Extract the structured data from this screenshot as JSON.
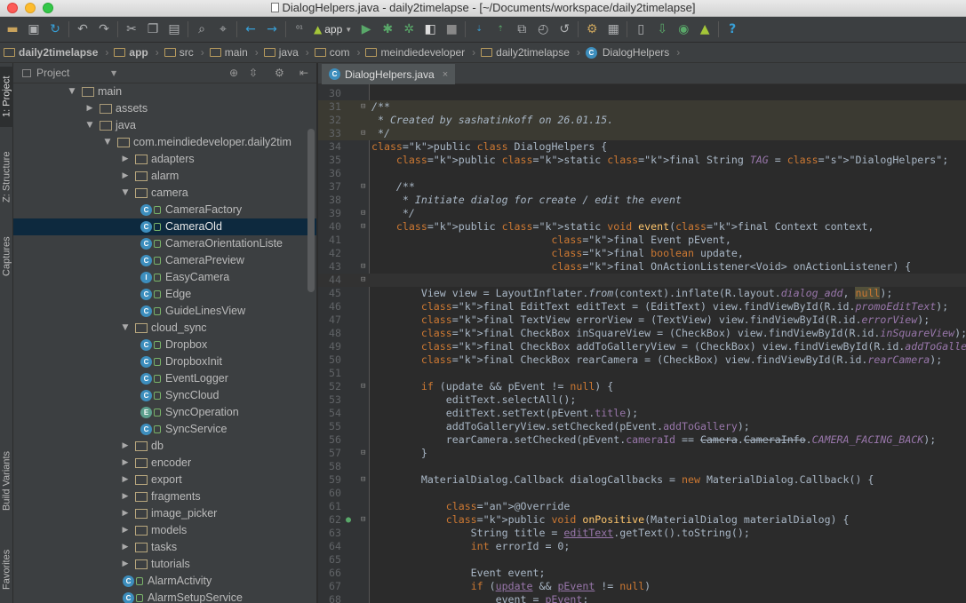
{
  "window": {
    "title": "DialogHelpers.java - daily2timelapse - [~/Documents/workspace/daily2timelapse]"
  },
  "toolbar": {
    "run_config": "app"
  },
  "breadcrumb": [
    "daily2timelapse",
    "app",
    "src",
    "main",
    "java",
    "com",
    "meindiedeveloper",
    "daily2timelapse",
    "DialogHelpers"
  ],
  "left_tabs": {
    "project": "1: Project",
    "structure": "Z: Structure",
    "captures": "Captures",
    "build_variants": "Build Variants",
    "favorites": "Favorites"
  },
  "project_panel": {
    "title": "Project"
  },
  "tree": [
    {
      "label": "main",
      "kind": "folder",
      "depth": 0,
      "expanded": true
    },
    {
      "label": "assets",
      "kind": "folder",
      "depth": 1,
      "expanded": false
    },
    {
      "label": "java",
      "kind": "folder",
      "depth": 1,
      "expanded": true
    },
    {
      "label": "com.meindiedeveloper.daily2tim",
      "kind": "package",
      "depth": 2,
      "expanded": true
    },
    {
      "label": "adapters",
      "kind": "package",
      "depth": 3,
      "expanded": false
    },
    {
      "label": "alarm",
      "kind": "package",
      "depth": 3,
      "expanded": false
    },
    {
      "label": "camera",
      "kind": "package",
      "depth": 3,
      "expanded": true
    },
    {
      "label": "CameraFactory",
      "kind": "class",
      "depth": 4
    },
    {
      "label": "CameraOld",
      "kind": "class",
      "depth": 4,
      "selected": true
    },
    {
      "label": "CameraOrientationListe",
      "kind": "class",
      "depth": 4
    },
    {
      "label": "CameraPreview",
      "kind": "class",
      "depth": 4
    },
    {
      "label": "EasyCamera",
      "kind": "interface",
      "depth": 4
    },
    {
      "label": "Edge",
      "kind": "class",
      "depth": 4
    },
    {
      "label": "GuideLinesView",
      "kind": "class",
      "depth": 4
    },
    {
      "label": "cloud_sync",
      "kind": "package",
      "depth": 3,
      "expanded": true
    },
    {
      "label": "Dropbox",
      "kind": "class",
      "depth": 4
    },
    {
      "label": "DropboxInit",
      "kind": "class",
      "depth": 4
    },
    {
      "label": "EventLogger",
      "kind": "class",
      "depth": 4
    },
    {
      "label": "SyncCloud",
      "kind": "class",
      "depth": 4
    },
    {
      "label": "SyncOperation",
      "kind": "enum",
      "depth": 4
    },
    {
      "label": "SyncService",
      "kind": "class",
      "depth": 4
    },
    {
      "label": "db",
      "kind": "package",
      "depth": 3,
      "expanded": false
    },
    {
      "label": "encoder",
      "kind": "package",
      "depth": 3,
      "expanded": false
    },
    {
      "label": "export",
      "kind": "package",
      "depth": 3,
      "expanded": false
    },
    {
      "label": "fragments",
      "kind": "package",
      "depth": 3,
      "expanded": false
    },
    {
      "label": "image_picker",
      "kind": "package",
      "depth": 3,
      "expanded": false
    },
    {
      "label": "models",
      "kind": "package",
      "depth": 3,
      "expanded": false
    },
    {
      "label": "tasks",
      "kind": "package",
      "depth": 3,
      "expanded": false
    },
    {
      "label": "tutorials",
      "kind": "package",
      "depth": 3,
      "expanded": false
    },
    {
      "label": "AlarmActivity",
      "kind": "class",
      "depth": 3
    },
    {
      "label": "AlarmSetupService",
      "kind": "class",
      "depth": 3
    }
  ],
  "editor": {
    "tab": "DialogHelpers.java",
    "lines": [
      {
        "n": "30",
        "t": ""
      },
      {
        "n": "31",
        "t": "/**",
        "c": "cm",
        "bg": true
      },
      {
        "n": "32",
        "t": " * Created by sashatinkoff on 26.01.15.",
        "c": "cm",
        "bg": true
      },
      {
        "n": "33",
        "t": " */",
        "c": "cm",
        "bg": true
      },
      {
        "n": "34",
        "t": "public class DialogHelpers {"
      },
      {
        "n": "35",
        "t": "    public static final String TAG = \"DialogHelpers\";"
      },
      {
        "n": "36",
        "t": ""
      },
      {
        "n": "37",
        "t": "    /**",
        "c": "cm"
      },
      {
        "n": "38",
        "t": "     * Initiate dialog for create / edit the event",
        "c": "cm"
      },
      {
        "n": "39",
        "t": "     */",
        "c": "cm"
      },
      {
        "n": "40",
        "t": "    public static void event(final Context context,"
      },
      {
        "n": "41",
        "t": "                             final Event pEvent,"
      },
      {
        "n": "42",
        "t": "                             final boolean update,"
      },
      {
        "n": "43",
        "t": "                             final OnActionListener<Void> onActionListener) {"
      },
      {
        "n": "44",
        "t": "",
        "cur": true
      },
      {
        "n": "45",
        "t": "        View view = LayoutInflater.from(context).inflate(R.layout.dialog_add, null);"
      },
      {
        "n": "46",
        "t": "        final EditText editText = (EditText) view.findViewById(R.id.promoEditText);"
      },
      {
        "n": "47",
        "t": "        final TextView errorView = (TextView) view.findViewById(R.id.errorView);"
      },
      {
        "n": "48",
        "t": "        final CheckBox inSquareView = (CheckBox) view.findViewById(R.id.inSquareView);"
      },
      {
        "n": "49",
        "t": "        final CheckBox addToGalleryView = (CheckBox) view.findViewById(R.id.addToGalleryView);"
      },
      {
        "n": "50",
        "t": "        final CheckBox rearCamera = (CheckBox) view.findViewById(R.id.rearCamera);"
      },
      {
        "n": "51",
        "t": ""
      },
      {
        "n": "52",
        "t": "        if (update && pEvent != null) {"
      },
      {
        "n": "53",
        "t": "            editText.selectAll();"
      },
      {
        "n": "54",
        "t": "            editText.setText(pEvent.title);"
      },
      {
        "n": "55",
        "t": "            addToGalleryView.setChecked(pEvent.addToGallery);"
      },
      {
        "n": "56",
        "t": "            rearCamera.setChecked(pEvent.cameraId == Camera.CameraInfo.CAMERA_FACING_BACK);"
      },
      {
        "n": "57",
        "t": "        }"
      },
      {
        "n": "58",
        "t": ""
      },
      {
        "n": "59",
        "t": "        MaterialDialog.Callback dialogCallbacks = new MaterialDialog.Callback() {"
      },
      {
        "n": "60",
        "t": ""
      },
      {
        "n": "61",
        "t": "            @Override"
      },
      {
        "n": "62",
        "t": "            public void onPositive(MaterialDialog materialDialog) {"
      },
      {
        "n": "63",
        "t": "                String title = editText.getText().toString();"
      },
      {
        "n": "64",
        "t": "                int errorId = 0;"
      },
      {
        "n": "65",
        "t": ""
      },
      {
        "n": "66",
        "t": "                Event event;"
      },
      {
        "n": "67",
        "t": "                if (update && pEvent != null)"
      },
      {
        "n": "68",
        "t": "                    event = pEvent;"
      }
    ]
  }
}
